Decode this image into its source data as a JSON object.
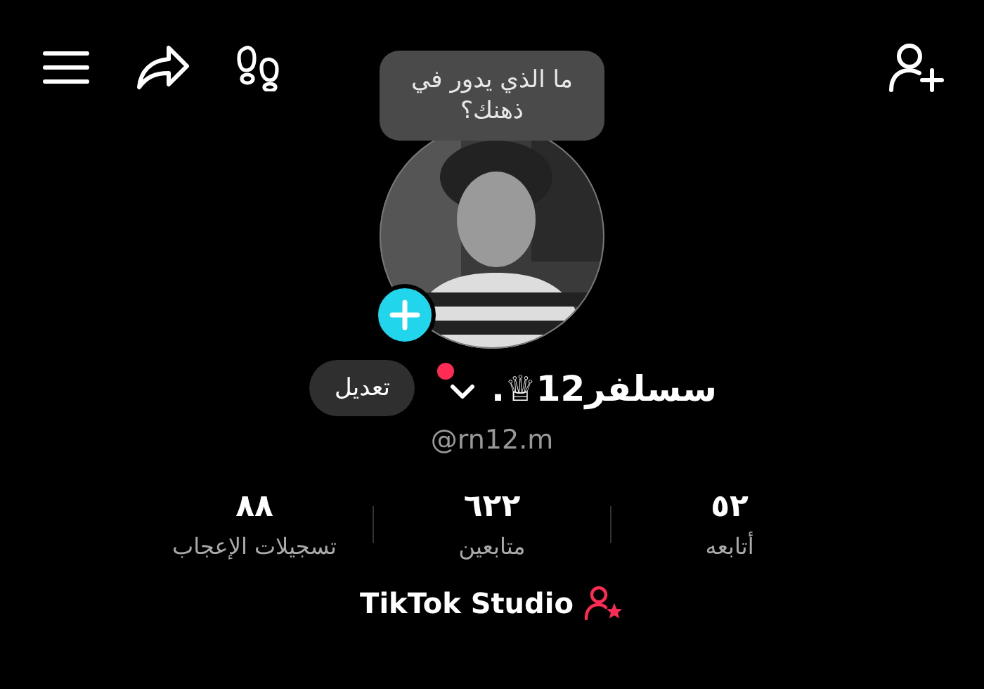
{
  "bubble": {
    "text": "ما الذي يدور في ذهنك؟"
  },
  "avatar": {
    "has_add_button": true
  },
  "profile": {
    "name": "سسلفر12♕.",
    "has_dropdown": true,
    "notification_dot": true,
    "edit_button": "تعديل",
    "handle": "@rn12.m"
  },
  "stats": [
    {
      "value": "٥٢",
      "label": "أتابعه"
    },
    {
      "value": "٦٢٢",
      "label": "متابعين"
    },
    {
      "value": "٨٨",
      "label": "تسجيلات الإعجاب"
    }
  ],
  "studio": {
    "label": "TikTok Studio"
  }
}
